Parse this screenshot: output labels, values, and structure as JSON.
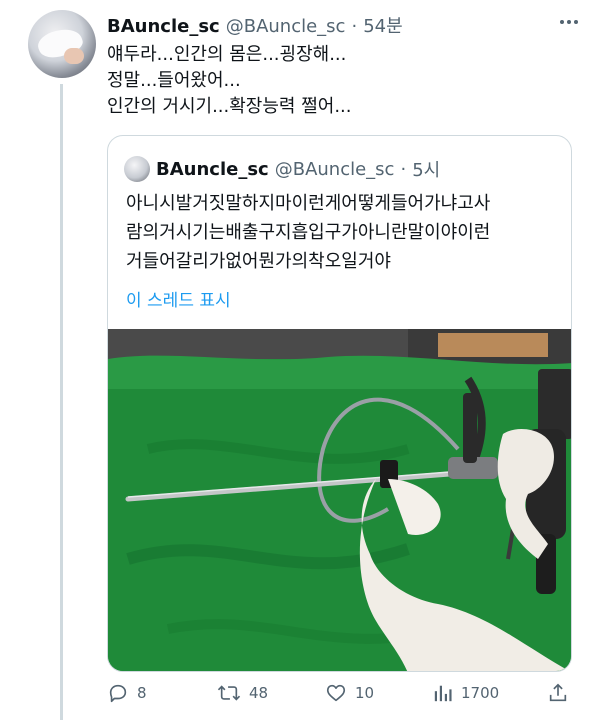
{
  "tweet": {
    "author_name": "BAuncle_sc",
    "author_handle": "@BAuncle_sc",
    "separator": "·",
    "time": "54분",
    "lines": [
      "얘두라...인간의 몸은...굉장해...",
      "정말...들어왔어...",
      "인간의 거시기...확장능력 쩔어..."
    ]
  },
  "quote": {
    "author_name": "BAuncle_sc",
    "author_handle": "@BAuncle_sc",
    "separator": "·",
    "time": "5시",
    "lines": [
      "아니시발거짓말하지마이런게어떻게들어가냐고사",
      "람의거시기는배출구지흡입구가아니란말이야이런",
      "거들어갈리가없어뭔가의착오일거야"
    ],
    "show_thread": "이 스레드 표시"
  },
  "actions": {
    "reply_count": "8",
    "retweet_count": "48",
    "like_count": "10",
    "view_count": "1700"
  },
  "icons": {
    "reply": "reply-icon",
    "retweet": "retweet-icon",
    "like": "heart-icon",
    "views": "views-icon",
    "share": "share-icon",
    "more": "more-icon"
  },
  "colors": {
    "link": "#1d9bf0",
    "secondary_text": "#536471",
    "border": "#cfd9de",
    "photo_background": "#1f8a39"
  }
}
